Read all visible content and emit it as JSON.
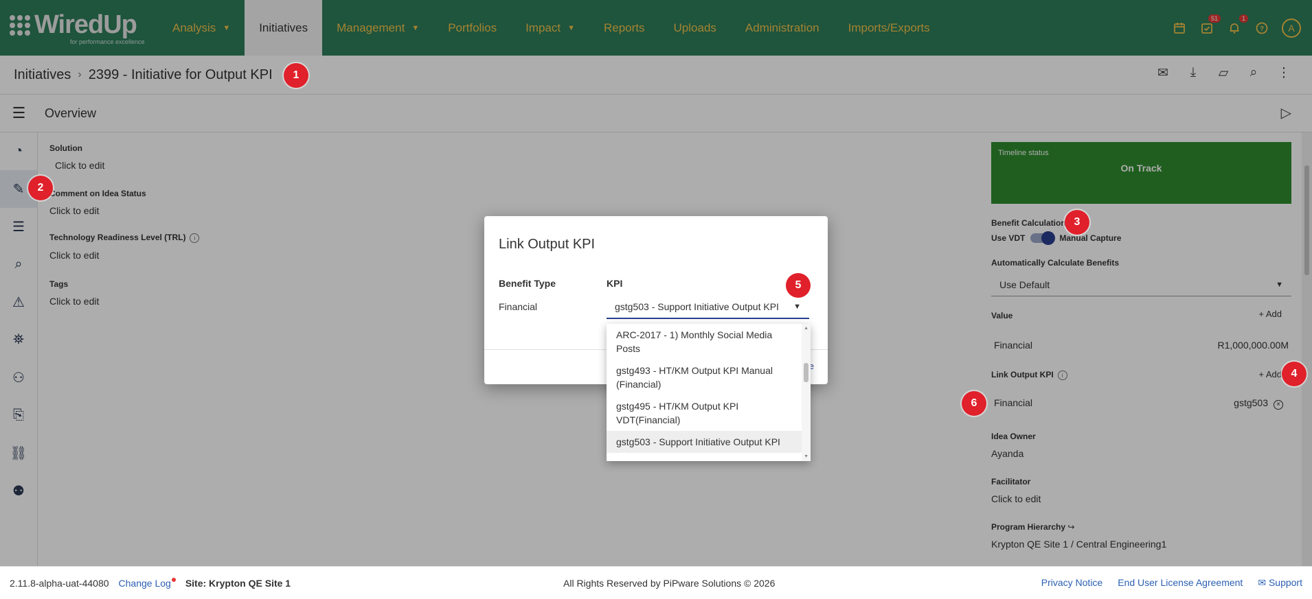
{
  "brand": {
    "name": "WiredUp",
    "tagline": "for performance excellence"
  },
  "nav": {
    "items": [
      {
        "label": "Analysis",
        "has_caret": true,
        "caret": "▼"
      },
      {
        "label": "Initiatives",
        "has_caret": false
      },
      {
        "label": "Management",
        "has_caret": true,
        "caret": "▼"
      },
      {
        "label": "Portfolios",
        "has_caret": false
      },
      {
        "label": "Impact",
        "has_caret": true,
        "caret": "▼"
      },
      {
        "label": "Reports",
        "has_caret": false
      },
      {
        "label": "Uploads",
        "has_caret": false
      },
      {
        "label": "Administration",
        "has_caret": false
      },
      {
        "label": "Imports/Exports",
        "has_caret": false
      }
    ],
    "active": "Initiatives",
    "tasks_badge": "51",
    "notifications_badge": "1",
    "avatar_initial": "A",
    "accent_color": "#f0c24a",
    "bar_color": "#2e7d5b"
  },
  "breadcrumb": {
    "root": "Initiatives",
    "separator": "›",
    "current": "2399 - Initiative for Output KPI"
  },
  "overview": {
    "title": "Overview"
  },
  "fields": {
    "solution_label": "Solution",
    "solution_value": "Click to edit",
    "comment_label": "Comment on Idea Status",
    "comment_value": "Click to edit",
    "trl_label": "Technology Readiness Level (TRL)",
    "trl_value": "Click to edit",
    "tags_label": "Tags",
    "tags_value": "Click to edit"
  },
  "right_panel": {
    "timeline_label": "Timeline status",
    "timeline_value": "On Track",
    "timeline_color": "#2e8b2e",
    "benefit_calc_label": "Benefit Calculation",
    "toggle_left": "Use VDT",
    "toggle_right": "Manual Capture",
    "auto_calc_label": "Automatically Calculate Benefits",
    "auto_calc_value": "Use Default",
    "value_label": "Value",
    "add_label": "Add",
    "value_row_name": "Financial",
    "value_row_amount": "R1,000,000.00M",
    "link_kpi_label": "Link Output KPI",
    "link_kpi_row_name": "Financial",
    "link_kpi_row_value": "gstg503",
    "idea_owner_label": "Idea Owner",
    "idea_owner_value": "Ayanda",
    "facilitator_label": "Facilitator",
    "facilitator_value": "Click to edit",
    "program_label": "Program Hierarchy",
    "program_value": "Krypton QE Site 1 / Central Engineering1"
  },
  "dialog": {
    "title": "Link Output KPI",
    "col_benefit": "Benefit Type",
    "col_kpi": "KPI",
    "benefit_value": "Financial",
    "kpi_selected": "gstg503 - Support Initiative Output KPI",
    "footer_fragment": "e"
  },
  "dropdown": {
    "options": [
      "ARC-2017 - 1) Monthly Social Media Posts",
      "gstg493 - HT/KM Output KPI Manual (Financial)",
      "gstg495 - HT/KM Output KPI VDT(Financial)",
      "gstg503 - Support Initiative Output KPI"
    ],
    "selected_index": 3
  },
  "markers": [
    "1",
    "2",
    "3",
    "4",
    "5",
    "6"
  ],
  "footer": {
    "version": "2.11.8-alpha-uat-44080",
    "changelog": "Change Log",
    "site": "Site: Krypton QE Site 1",
    "copyright": "All Rights Reserved by PiPware Solutions © 2026",
    "privacy": "Privacy Notice",
    "eula": "End User License Agreement",
    "support": "Support"
  }
}
